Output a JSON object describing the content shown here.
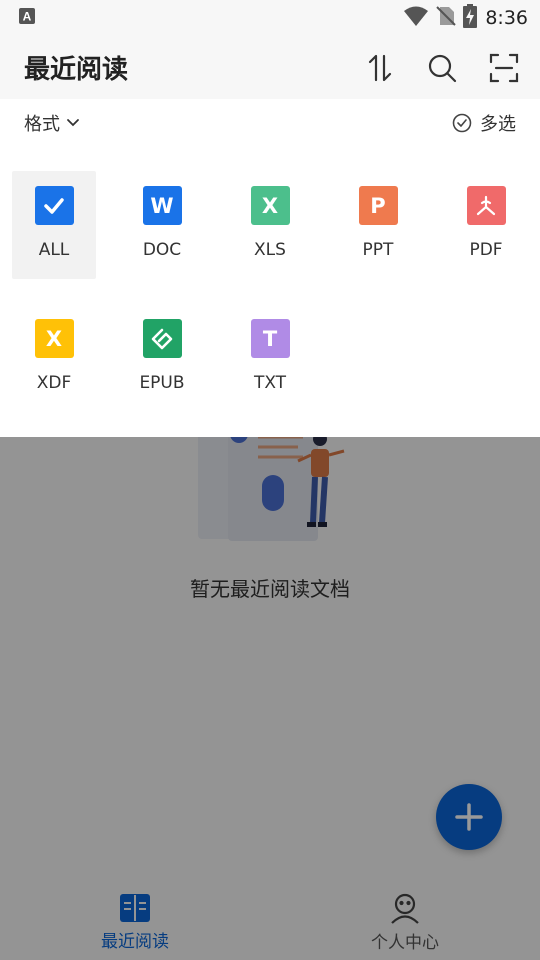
{
  "status_bar": {
    "time": "8:36",
    "icons": [
      "font-icon",
      "wifi-icon",
      "no-sim-icon",
      "battery-charging-icon"
    ]
  },
  "header": {
    "title": "最近阅读",
    "actions": [
      "sort-icon",
      "search-icon",
      "scan-icon"
    ]
  },
  "filter_panel": {
    "format_label": "格式",
    "multi_select_label": "多选",
    "formats": [
      {
        "label": "ALL",
        "icon": "check-icon",
        "color": "#1a73e8",
        "selected": true
      },
      {
        "label": "DOC",
        "icon": "word-icon",
        "color": "#1a73e8",
        "glyph": "W"
      },
      {
        "label": "XLS",
        "icon": "excel-icon",
        "color": "#4cbf8c",
        "glyph": "X"
      },
      {
        "label": "PPT",
        "icon": "powerpoint-icon",
        "color": "#ef7a4e",
        "glyph": "P"
      },
      {
        "label": "PDF",
        "icon": "pdf-icon",
        "color": "#f06a6a"
      },
      {
        "label": "XDF",
        "icon": "xdf-icon",
        "color": "#ffc107",
        "glyph": "X"
      },
      {
        "label": "EPUB",
        "icon": "epub-icon",
        "color": "#21a366"
      },
      {
        "label": "TXT",
        "icon": "txt-icon",
        "color": "#b08be6",
        "glyph": "T"
      }
    ]
  },
  "empty_state": {
    "text": "暂无最近阅读文档"
  },
  "fab": {
    "icon": "plus-icon"
  },
  "bottom_nav": {
    "items": [
      {
        "label": "最近阅读",
        "icon": "book-icon",
        "active": true
      },
      {
        "label": "个人中心",
        "icon": "profile-icon",
        "active": false
      }
    ]
  },
  "colors": {
    "accent": "#0a64d6",
    "scrim": "rgba(0,0,0,0.40)"
  }
}
